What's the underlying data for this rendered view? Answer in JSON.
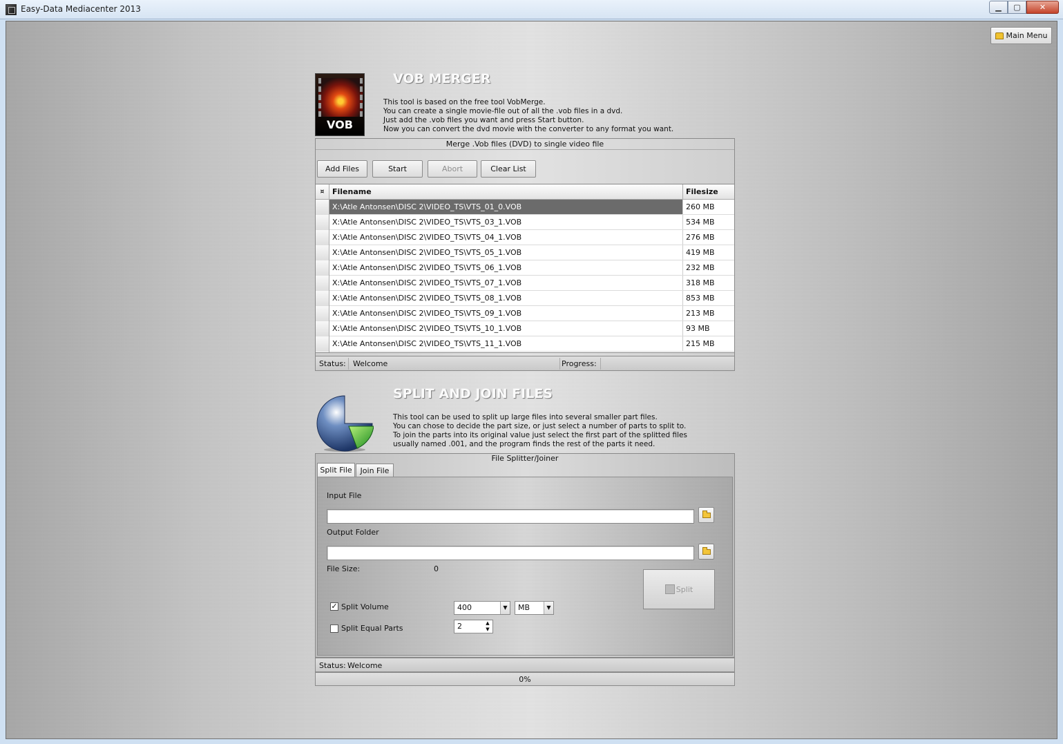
{
  "window": {
    "title": "Easy-Data Mediacenter 2013",
    "min": "▁",
    "max": "▢",
    "close": "✕"
  },
  "main_menu_label": "Main Menu",
  "vob": {
    "title": "VOB MERGER",
    "icon_label": "VOB",
    "description": [
      "This tool is based on the free tool VobMerge.",
      "You can create a single movie-file out of all the .vob files in a dvd.",
      "Just add the .vob files you want and press Start button.",
      "Now you can convert the dvd movie with the converter to any format you want."
    ],
    "panel_caption": "Merge .Vob files (DVD) to single video file",
    "buttons": {
      "add": "Add Files",
      "start": "Start",
      "abort": "Abort",
      "clear": "Clear List"
    },
    "columns": {
      "sel": "¤",
      "filename": "Filename",
      "filesize": "Filesize"
    },
    "rows": [
      {
        "filename": "X:\\Atle Antonsen\\DISC 2\\VIDEO_TS\\VTS_01_0.VOB",
        "size": "260 MB"
      },
      {
        "filename": "X:\\Atle Antonsen\\DISC 2\\VIDEO_TS\\VTS_03_1.VOB",
        "size": "534 MB"
      },
      {
        "filename": "X:\\Atle Antonsen\\DISC 2\\VIDEO_TS\\VTS_04_1.VOB",
        "size": "276 MB"
      },
      {
        "filename": "X:\\Atle Antonsen\\DISC 2\\VIDEO_TS\\VTS_05_1.VOB",
        "size": "419 MB"
      },
      {
        "filename": "X:\\Atle Antonsen\\DISC 2\\VIDEO_TS\\VTS_06_1.VOB",
        "size": "232 MB"
      },
      {
        "filename": "X:\\Atle Antonsen\\DISC 2\\VIDEO_TS\\VTS_07_1.VOB",
        "size": "318 MB"
      },
      {
        "filename": "X:\\Atle Antonsen\\DISC 2\\VIDEO_TS\\VTS_08_1.VOB",
        "size": "853 MB"
      },
      {
        "filename": "X:\\Atle Antonsen\\DISC 2\\VIDEO_TS\\VTS_09_1.VOB",
        "size": "213 MB"
      },
      {
        "filename": "X:\\Atle Antonsen\\DISC 2\\VIDEO_TS\\VTS_10_1.VOB",
        "size": "93 MB"
      },
      {
        "filename": "X:\\Atle Antonsen\\DISC 2\\VIDEO_TS\\VTS_11_1.VOB",
        "size": "215 MB"
      }
    ],
    "status_label": "Status:",
    "status_value": "Welcome",
    "progress_label": "Progress:"
  },
  "split": {
    "title": "SPLIT AND JOIN FILES",
    "description": [
      "This tool can be used to split up large files into several smaller part files.",
      "You can chose to decide the part size, or just select a number of parts to split to.",
      "To join the parts into its original value just select the first part of the splitted files",
      "usually named .001, and the program finds the rest of the parts it need."
    ],
    "panel_caption": "File Splitter/Joiner",
    "tabs": [
      "Split File",
      "Join File"
    ],
    "input_file_label": "Input File",
    "input_file_value": "",
    "output_folder_label": "Output Folder",
    "output_folder_value": "",
    "file_size_label": "File Size:",
    "file_size_value": "0",
    "split_volume_label": "Split Volume",
    "split_volume_checked": true,
    "split_volume_value": "400",
    "unit_value": "MB",
    "split_equal_label": "Split Equal Parts",
    "split_equal_checked": false,
    "split_equal_value": "2",
    "split_button": "Split",
    "status_label": "Status:",
    "status_value": "Welcome",
    "progress_text": "0%"
  }
}
